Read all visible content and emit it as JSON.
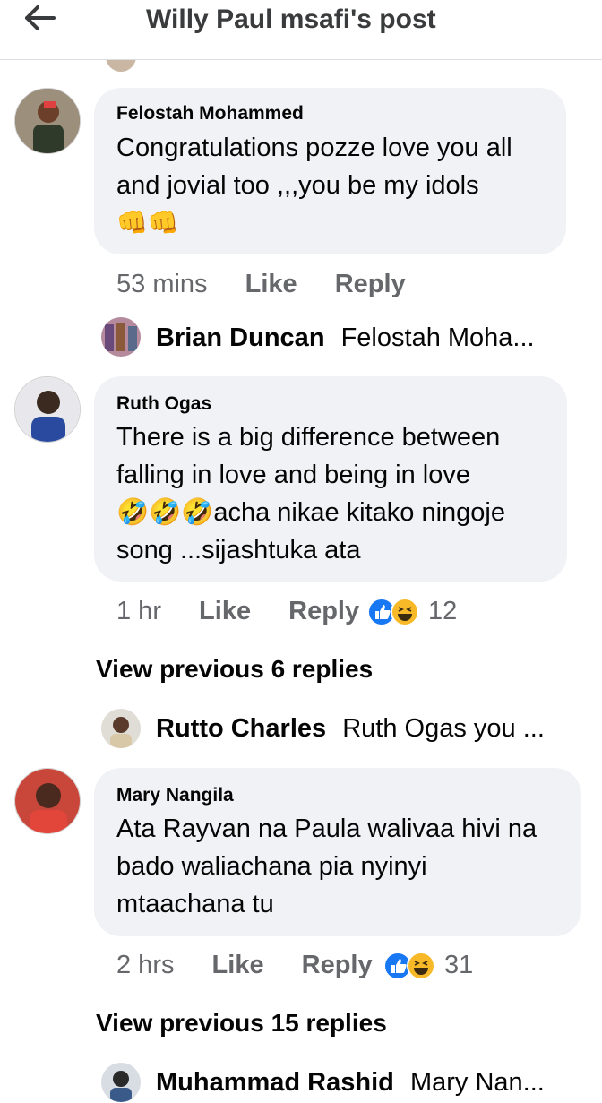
{
  "header": {
    "title": "Willy Paul msafi's post",
    "back_icon": "arrow-left-icon"
  },
  "comments": [
    {
      "author": "Felostah Mohammed",
      "lines": [
        "Congratulations pozze love you all",
        "and jovial too ,,,you be my idols"
      ],
      "emoji_line": "👊👊",
      "time": "53 mins",
      "like": "Like",
      "reply": "Reply",
      "reply_preview": {
        "name": "Brian Duncan",
        "text": "Felostah Moha..."
      }
    },
    {
      "author": "Ruth Ogas",
      "lines": [
        "There is a big difference between",
        "falling in love and being in love",
        "🤣🤣🤣acha nikae kitako ningoje",
        "song ...sijashtuka ata"
      ],
      "time": "1 hr",
      "like": "Like",
      "reply": "Reply",
      "reactions_count": "12",
      "view_previous": "View previous 6 replies",
      "reply_preview": {
        "name": "Rutto Charles",
        "text": "Ruth Ogas you ..."
      }
    },
    {
      "author": "Mary Nangila",
      "lines": [
        "Ata Rayvan na Paula walivaa hivi na",
        "bado waliachana pia nyinyi",
        "mtaachana tu"
      ],
      "time": "2 hrs",
      "like": "Like",
      "reply": "Reply",
      "reactions_count": "31",
      "view_previous": "View previous 15 replies",
      "reply_preview": {
        "name": "Muhammad Rashid",
        "text": "Mary Nan..."
      }
    }
  ],
  "colors": {
    "bubble": "#f0f2f5",
    "meta": "#65676b",
    "like_blue": "#1877f2",
    "haha_yellow": "#f7b928"
  }
}
